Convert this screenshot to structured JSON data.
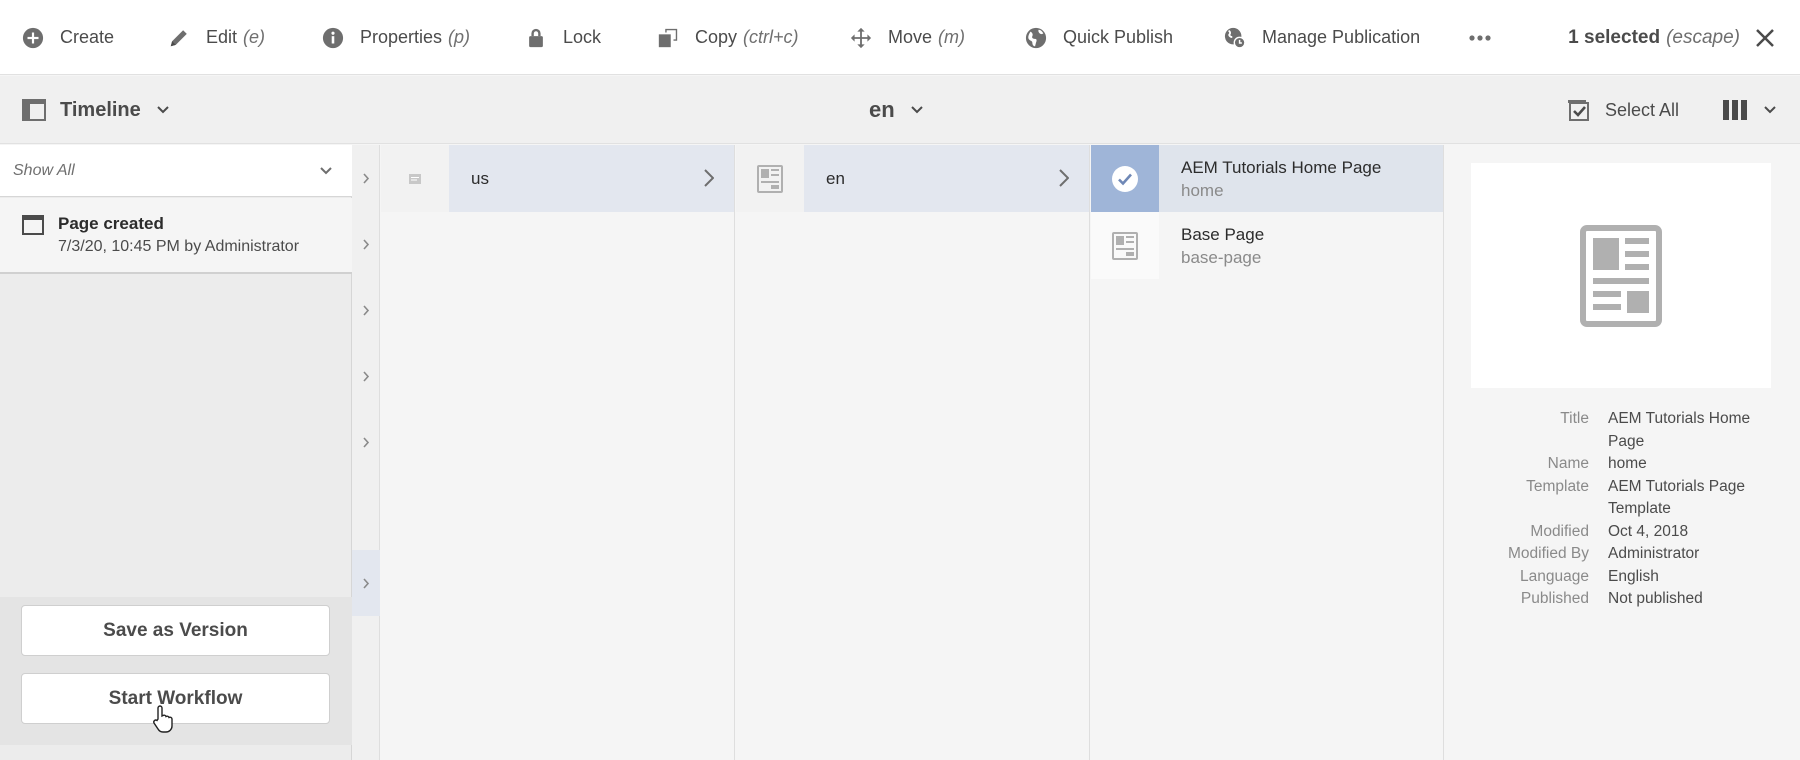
{
  "actionbar": {
    "create": "Create",
    "edit": "Edit",
    "edit_shortcut": "(e)",
    "properties": "Properties",
    "properties_shortcut": "(p)",
    "lock": "Lock",
    "copy": "Copy",
    "copy_shortcut": "(ctrl+c)",
    "move": "Move",
    "move_shortcut": "(m)",
    "quick_publish": "Quick Publish",
    "manage_publication": "Manage Publication",
    "selection_count": "1 selected",
    "selection_hint": "(escape)"
  },
  "secondary": {
    "rail_label": "Timeline",
    "breadcrumb": "en",
    "select_all": "Select All"
  },
  "rail": {
    "filter": "Show All",
    "items": [
      {
        "title": "Page created",
        "meta": "7/3/20, 10:45 PM by Administrator"
      }
    ],
    "save_version": "Save as Version",
    "start_workflow": "Start Workflow"
  },
  "columns": {
    "col1": [
      {
        "title": "us"
      }
    ],
    "col2": [
      {
        "title": "en"
      }
    ],
    "col3": [
      {
        "title": "AEM Tutorials Home Page",
        "name": "home"
      },
      {
        "title": "Base Page",
        "name": "base-page"
      }
    ]
  },
  "details": [
    {
      "label": "Title",
      "value": "AEM Tutorials Home Page"
    },
    {
      "label": "Name",
      "value": "home"
    },
    {
      "label": "Template",
      "value": "AEM Tutorials Page Template"
    },
    {
      "label": "Modified",
      "value": "Oct 4, 2018"
    },
    {
      "label": "Modified By",
      "value": "Administrator"
    },
    {
      "label": "Language",
      "value": "English"
    },
    {
      "label": "Published",
      "value": "Not published"
    }
  ],
  "colors": {
    "accent_selected": "#9fb5d8",
    "row_navigated": "#e3e7ef",
    "icon_gray": "#6e6e6e"
  },
  "icons": {
    "create": "add-circle-icon",
    "edit": "pencil-icon",
    "properties": "info-icon",
    "lock": "lock-icon",
    "copy": "copy-icon",
    "move": "move-icon",
    "quick_publish": "globe-icon",
    "manage_publication": "globe-clock-icon",
    "more": "more-icon",
    "close": "close-icon"
  }
}
